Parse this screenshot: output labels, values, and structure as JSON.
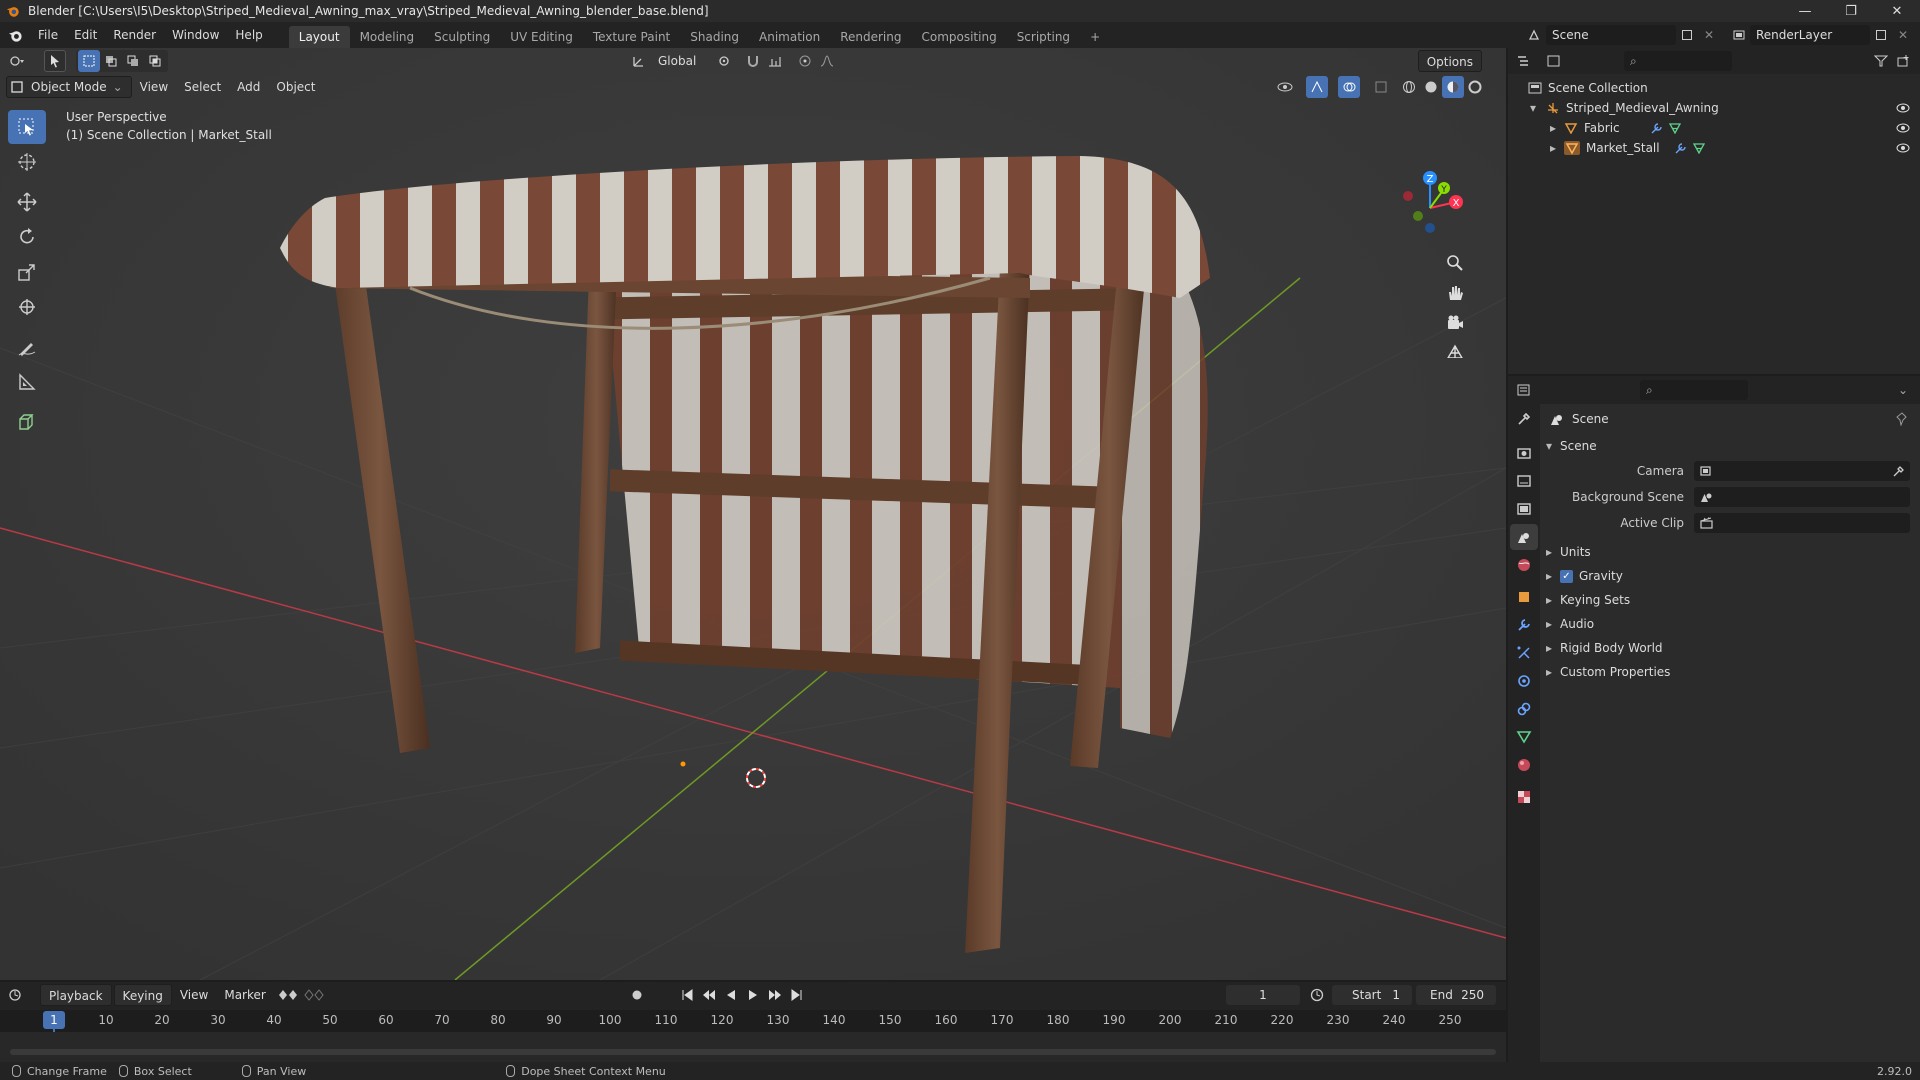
{
  "window": {
    "title": "Blender [C:\\Users\\I5\\Desktop\\Striped_Medieval_Awning_max_vray\\Striped_Medieval_Awning_blender_base.blend]",
    "minimize": "—",
    "maximize": "❐",
    "close": "✕"
  },
  "menu": [
    "File",
    "Edit",
    "Render",
    "Window",
    "Help"
  ],
  "workspaces": [
    "Layout",
    "Modeling",
    "Sculpting",
    "UV Editing",
    "Texture Paint",
    "Shading",
    "Animation",
    "Rendering",
    "Compositing",
    "Scripting"
  ],
  "workspace_add": "+",
  "scene_selector": {
    "value": "Scene"
  },
  "view_layer": {
    "value": "RenderLayer"
  },
  "viewport": {
    "mode": "Object Mode",
    "menus": [
      "View",
      "Select",
      "Add",
      "Object"
    ],
    "transform_orientation": "Global",
    "options": "Options",
    "info_line1": "User Perspective",
    "info_line2": "(1) Scene Collection | Market_Stall"
  },
  "outliner": {
    "root": "Scene Collection",
    "collection": "Striped_Medieval_Awning",
    "objects": [
      "Fabric",
      "Market_Stall"
    ]
  },
  "properties": {
    "context_title": "Scene",
    "panel_scene": "Scene",
    "camera_label": "Camera",
    "background_scene_label": "Background Scene",
    "active_clip_label": "Active Clip",
    "panels": [
      "Units",
      "Gravity",
      "Keying Sets",
      "Audio",
      "Rigid Body World",
      "Custom Properties"
    ],
    "gravity_checked": true
  },
  "timeline": {
    "menus": [
      "Playback",
      "Keying",
      "View",
      "Marker"
    ],
    "current_frame": "1",
    "start_label": "Start",
    "start_value": "1",
    "end_label": "End",
    "end_value": "250",
    "ticks": [
      "1",
      "10",
      "20",
      "30",
      "40",
      "50",
      "60",
      "70",
      "80",
      "90",
      "100",
      "110",
      "120",
      "130",
      "140",
      "150",
      "160",
      "170",
      "180",
      "190",
      "200",
      "210",
      "220",
      "230",
      "240",
      "250"
    ]
  },
  "statusbar": {
    "change_frame": "Change Frame",
    "box_select": "Box Select",
    "pan_view": "Pan View",
    "context_menu": "Dope Sheet Context Menu",
    "version": "2.92.0"
  },
  "colors": {
    "accent": "#4772b3",
    "axis_x": "#ff3352",
    "axis_y": "#8bdc00",
    "axis_z": "#2890ff"
  }
}
